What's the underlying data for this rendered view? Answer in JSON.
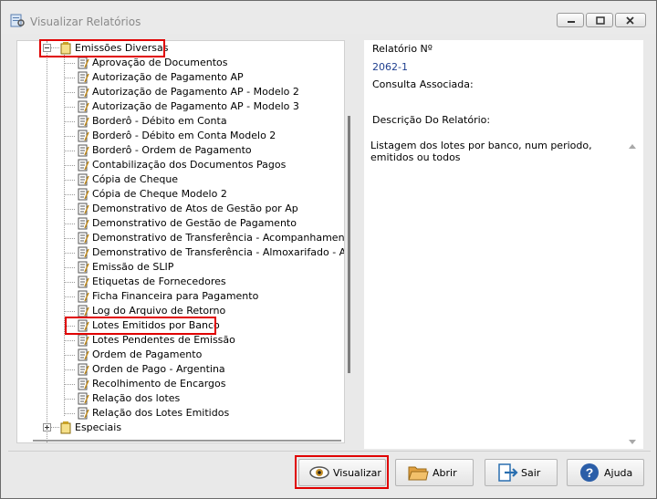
{
  "window": {
    "title": "Visualizar Relatórios"
  },
  "tree": {
    "parent_label": "Emissões Diversas",
    "items": [
      "Aprovação de Documentos",
      "Autorização de Pagamento AP",
      "Autorização de Pagamento AP - Modelo 2",
      "Autorização de Pagamento AP - Modelo 3",
      "Borderô - Débito em Conta",
      "Borderô - Débito em Conta Modelo 2",
      "Borderô - Ordem de Pagamento",
      "Contabilização dos Documentos Pagos",
      "Cópia de Cheque",
      "Cópia de Cheque Modelo 2",
      "Demonstrativo de Atos de Gestão por Ap",
      "Demonstrativo de Gestão de Pagamento",
      "Demonstrativo de Transferência - Acompanhamento",
      "Demonstrativo de Transferência - Almoxarifado - Agru",
      "Emissão de SLIP",
      "Etiquetas de Fornecedores",
      "Ficha Financeira para Pagamento",
      "Log do Arquivo de Retorno",
      "Lotes Emitidos por Banco",
      "Lotes Pendentes de Emissão",
      "Ordem de Pagamento",
      "Orden de Pago - Argentina",
      "Recolhimento de Encargos",
      "Relação dos lotes",
      "Relação dos Lotes Emitidos"
    ],
    "selected_item": "Lotes Emitidos por Banco",
    "next_group_label": "Especiais"
  },
  "details": {
    "report_number_label": "Relatório Nº",
    "report_number": "2062-1",
    "query_label": "Consulta Associada:",
    "description_label": "Descrição Do Relatório:",
    "description_line1": "Listagem dos lotes por banco, num periodo,",
    "description_line2": "emitidos ou todos"
  },
  "buttons": {
    "visualizar": "Visualizar",
    "abrir": "Abrir",
    "sair": "Sair",
    "ajuda": "Ajuda"
  },
  "colors": {
    "highlight": "#e00000",
    "report_number": "#1f3f8f"
  }
}
